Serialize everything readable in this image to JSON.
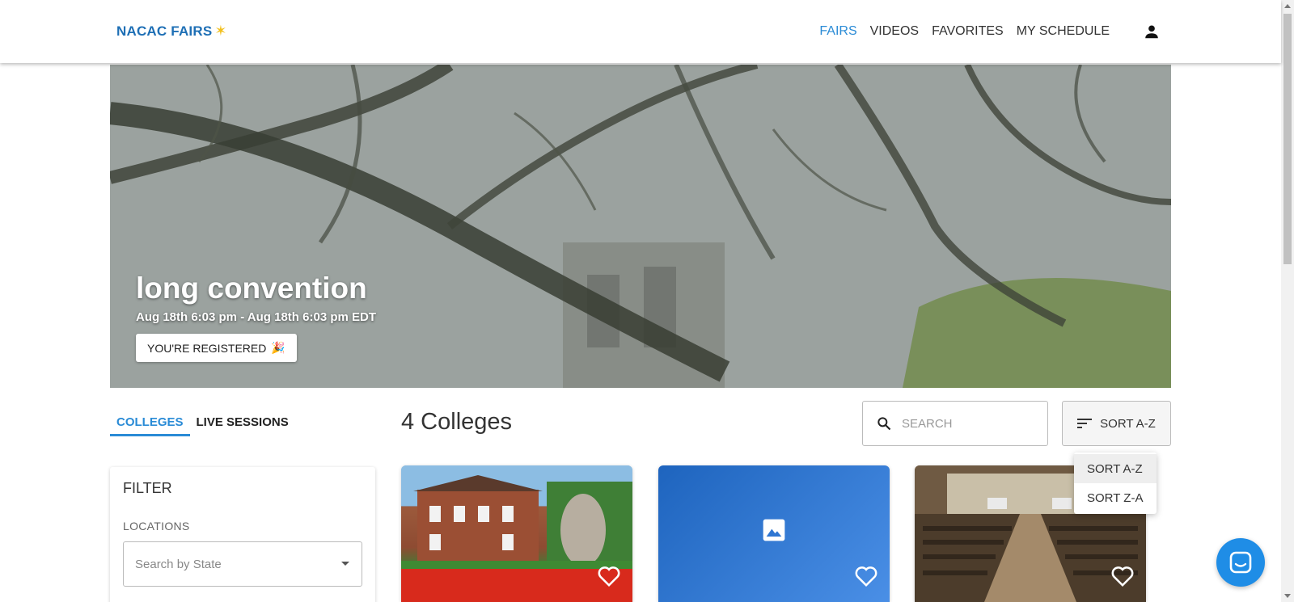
{
  "header": {
    "logo_text": "NACAC FAIRS",
    "logo_star": "✶",
    "nav": [
      {
        "label": "FAIRS",
        "active": true
      },
      {
        "label": "VIDEOS",
        "active": false
      },
      {
        "label": "FAVORITES",
        "active": false
      },
      {
        "label": "MY SCHEDULE",
        "active": false
      }
    ],
    "user_icon": "person-icon"
  },
  "hero": {
    "title": "long convention",
    "dates": "Aug 18th 6:03 pm - Aug 18th 6:03 pm EDT",
    "registered_label": "YOU'RE REGISTERED",
    "registered_emoji": "🎉"
  },
  "tabs": [
    {
      "label": "COLLEGES",
      "active": true
    },
    {
      "label": "LIVE SESSIONS",
      "active": false
    }
  ],
  "results": {
    "count_title": "4 Colleges"
  },
  "search": {
    "placeholder": "SEARCH"
  },
  "sort": {
    "label": "SORT A-Z",
    "options": [
      {
        "label": "SORT A-Z",
        "selected": true
      },
      {
        "label": "SORT Z-A",
        "selected": false
      }
    ]
  },
  "filter": {
    "title": "FILTER",
    "locations_label": "LOCATIONS",
    "state_placeholder": "Search by State"
  },
  "colors": {
    "accent": "#2a8bd6",
    "brand": "#1e6fb5",
    "chat": "#1f8de6"
  }
}
